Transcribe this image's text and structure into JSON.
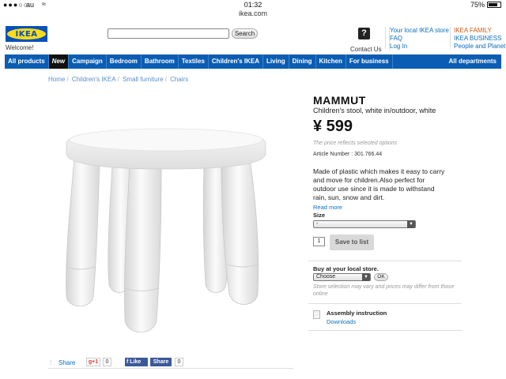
{
  "status_bar": {
    "signal": "●●●○○",
    "carrier": "au",
    "time": "01:32",
    "battery": "75%"
  },
  "url": "ikea.com",
  "header": {
    "logo": "IKEA",
    "welcome": "Welcome!",
    "search_button": "Search",
    "help_icon": "?",
    "contact": "Contact Us",
    "links_left": [
      "Your local IKEA store",
      "FAQ",
      "Log In"
    ],
    "links_right": [
      "IKEA FAMILY",
      "IKEA BUSINESS",
      "People and Planet"
    ]
  },
  "nav": {
    "items": [
      "All products",
      "New",
      "Campaign",
      "Bedroom",
      "Bathroom",
      "Textiles",
      "Children's IKEA",
      "Living",
      "Dining",
      "Kitchen",
      "For business"
    ],
    "all_departments": "All departments"
  },
  "breadcrumb": [
    "Home",
    "Children's IKEA",
    "Small furniture",
    "Chairs"
  ],
  "product": {
    "name": "MAMMUT",
    "subtitle": "Children's stool, white in/outdoor, white",
    "price": "¥ 599",
    "price_note": "The price reflects selected options",
    "article": "Article Number : 301.766.44",
    "description": "Made of plastic which makes it easy to carry and move for children.Also perfect for outdoor use since it is made to withstand rain, sun, snow and dirt.",
    "read_more": "Read more",
    "size_label": "Size",
    "size_value": "-",
    "quantity": "1",
    "save_button": "Save to list",
    "buy_label": "Buy at your local store.",
    "store_select": "Choose",
    "ok_button": "OK",
    "store_note": "Store selection may vary and prices may differ from those online",
    "assembly": "Assembly instruction",
    "downloads": "Downloads"
  },
  "share": {
    "share_label": "Share",
    "gplus_label": "g+1",
    "gplus_count": "0",
    "like_label": "Like",
    "fb_share_label": "Share",
    "fb_share_count": "0"
  },
  "colors": {
    "nav_blue": "#0b5db3",
    "link_blue": "#0b6ebf",
    "family_orange": "#d25a14",
    "ikea_yellow": "#ffda1a",
    "ikea_blue": "#0051ba"
  }
}
